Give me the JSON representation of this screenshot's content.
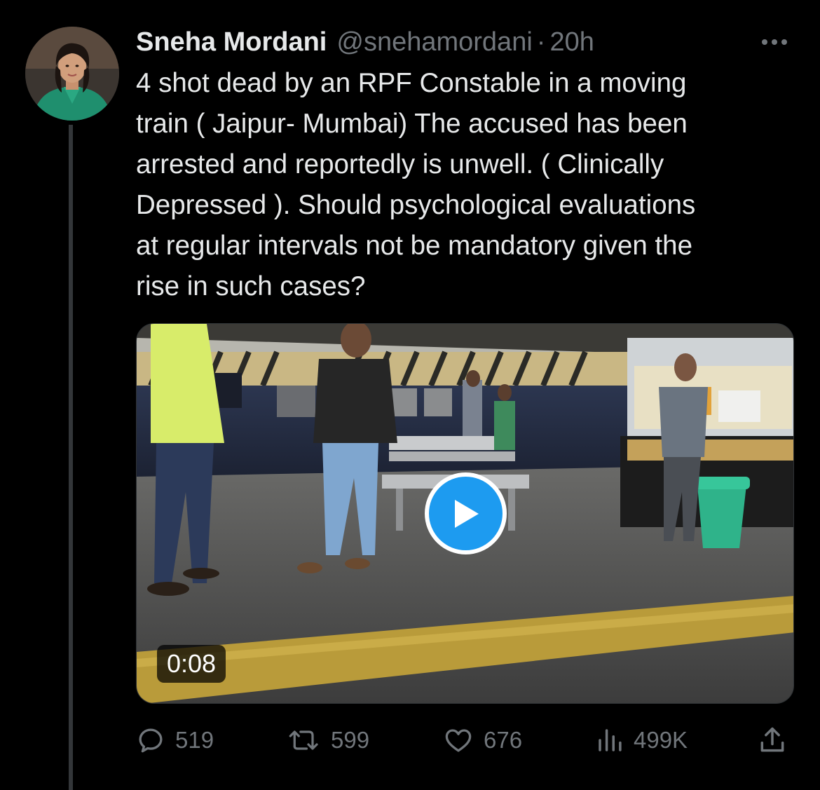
{
  "author": {
    "display_name": "Sneha Mordani",
    "handle": "@snehamordani",
    "separator": "·",
    "time": "20h"
  },
  "tweet": {
    "text": "4 shot dead by an RPF Constable in a moving\ntrain ( Jaipur- Mumbai) The accused has been\narrested and reportedly is unwell. ( Clinically\nDepressed ). Should psychological evaluations\nat regular intervals not be mandatory given the\nrise in such cases?"
  },
  "media": {
    "type": "video",
    "duration": "0:08",
    "play_icon": "play-icon"
  },
  "actions": {
    "replies": {
      "icon": "reply-icon",
      "count": "519"
    },
    "retweets": {
      "icon": "retweet-icon",
      "count": "599"
    },
    "likes": {
      "icon": "heart-icon",
      "count": "676"
    },
    "views": {
      "icon": "views-icon",
      "count": "499K"
    },
    "share": {
      "icon": "share-icon"
    }
  },
  "colors": {
    "background": "#000000",
    "text_primary": "#e7e9ea",
    "text_secondary": "#71767b",
    "accent": "#1d9bf0",
    "thread_line": "#333639"
  }
}
